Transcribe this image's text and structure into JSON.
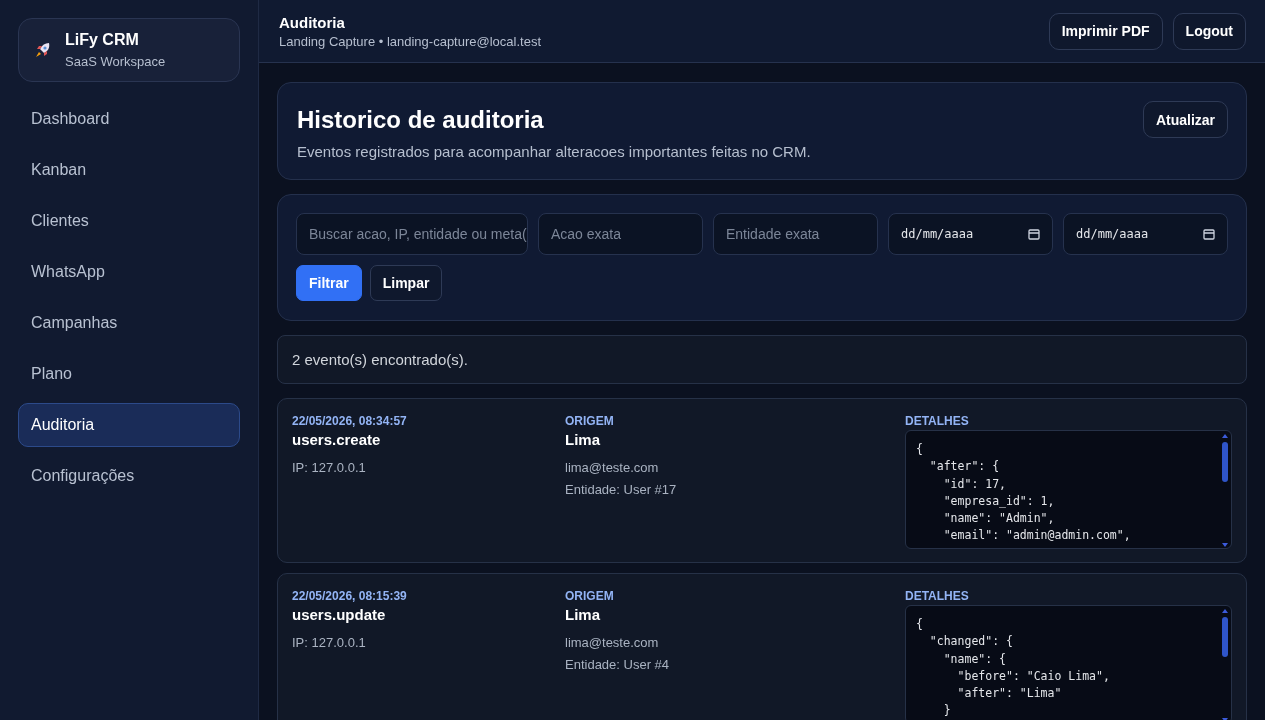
{
  "brand": {
    "name": "LiFy CRM",
    "subtitle": "SaaS Workspace"
  },
  "nav": [
    {
      "label": "Dashboard",
      "selected": false
    },
    {
      "label": "Kanban",
      "selected": false
    },
    {
      "label": "Clientes",
      "selected": false
    },
    {
      "label": "WhatsApp",
      "selected": false
    },
    {
      "label": "Campanhas",
      "selected": false
    },
    {
      "label": "Plano",
      "selected": false
    },
    {
      "label": "Auditoria",
      "selected": true
    },
    {
      "label": "Configurações",
      "selected": false
    }
  ],
  "topbar": {
    "title": "Auditoria",
    "subtitle": "Landing Capture • landing-capture@local.test",
    "buttons": [
      "Imprimir PDF",
      "Logout"
    ]
  },
  "header": {
    "title": "Historico de auditoria",
    "description": "Eventos registrados para acompanhar alteracoes importantes feitas no CRM.",
    "button": "Atualizar"
  },
  "filters": [
    {
      "kind": "text",
      "placeholder": "Buscar acao, IP, entidade ou meta("
    },
    {
      "kind": "text",
      "placeholder": "Acao exata"
    },
    {
      "kind": "text",
      "placeholder": "Entidade exata"
    },
    {
      "kind": "date",
      "placeholder": "dd/mm/aaaa"
    },
    {
      "kind": "date",
      "placeholder": "dd/mm/aaaa"
    }
  ],
  "filter_buttons": [
    {
      "label": "Filtrar",
      "kind": "primary"
    },
    {
      "label": "Limpar",
      "kind": "secondary"
    }
  ],
  "result_count": "2 evento(s) encontrado(s).",
  "events": [
    {
      "timestamp": "22/05/2026, 08:34:57",
      "action": "users.create",
      "ip": "IP: 127.0.0.1",
      "origin_label": "ORIGEM",
      "origin_name": "Lima",
      "origin_email": "lima@teste.com",
      "entity": "Entidade: User #17",
      "details_label": "DETALHES",
      "details": [
        "{",
        "  \"after\": {",
        "    \"id\": 17,",
        "    \"empresa_id\": 1,",
        "    \"name\": \"Admin\",",
        "    \"email\": \"admin@admin.com\","
      ]
    },
    {
      "timestamp": "22/05/2026, 08:15:39",
      "action": "users.update",
      "ip": "IP: 127.0.0.1",
      "origin_label": "ORIGEM",
      "origin_name": "Lima",
      "origin_email": "lima@teste.com",
      "entity": "Entidade: User #4",
      "details_label": "DETALHES",
      "details": [
        "{",
        "  \"changed\": {",
        "    \"name\": {",
        "      \"before\": \"Caio Lima\",",
        "      \"after\": \"Lima\"",
        "    }"
      ]
    }
  ]
}
